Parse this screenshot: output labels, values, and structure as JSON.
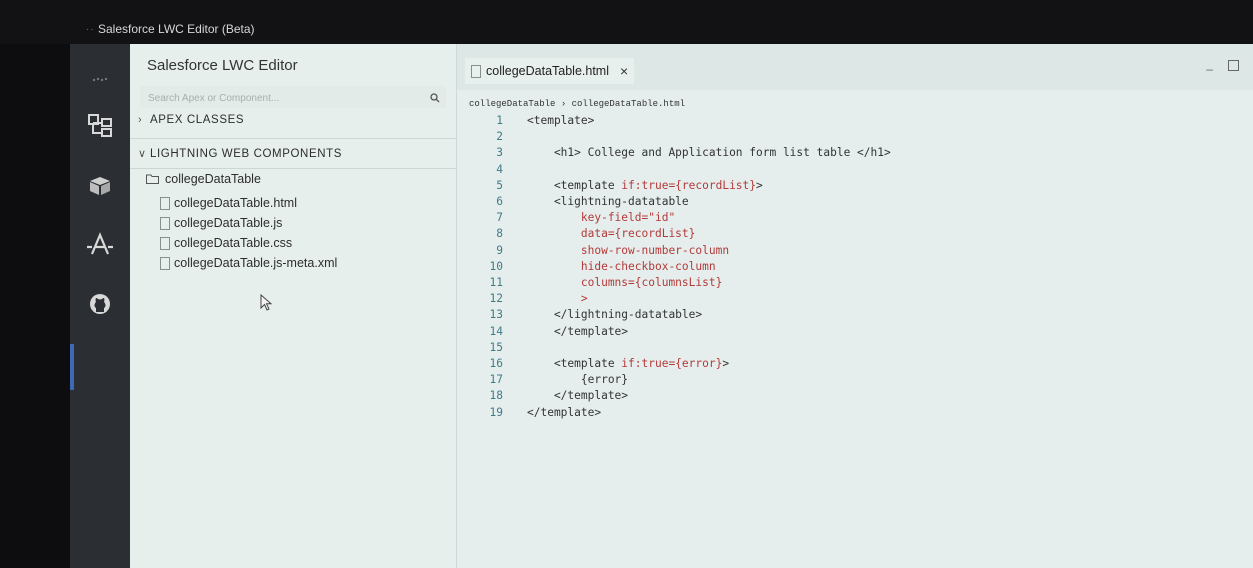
{
  "app": {
    "window_title": "Salesforce LWC Editor (Beta)"
  },
  "sidebar": {
    "brand": "Salesforce LWC Editor",
    "search_placeholder": "Search Apex or Component...",
    "sections": {
      "apex": "APEX CLASSES",
      "lwc": "LIGHTNING WEB COMPONENTS"
    },
    "folder": "collegeDataTable",
    "files": [
      "collegeDataTable.html",
      "collegeDataTable.js",
      "collegeDataTable.css",
      "collegeDataTable.js-meta.xml"
    ]
  },
  "editor": {
    "tab_label": "collegeDataTable.html",
    "tab_close": "×",
    "breadcrumb": "collegeDataTable › collegeDataTable.html",
    "lines": [
      {
        "n": "1",
        "segs": [
          {
            "t": "<template>",
            "c": "tag"
          }
        ]
      },
      {
        "n": "2",
        "segs": []
      },
      {
        "n": "3",
        "segs": [
          {
            "t": "    <h1> College and Application form list table </h1>",
            "c": "tag"
          }
        ]
      },
      {
        "n": "4",
        "segs": []
      },
      {
        "n": "5",
        "segs": [
          {
            "t": "    <template ",
            "c": "tag"
          },
          {
            "t": "if:true={recordList}",
            "c": "attr"
          },
          {
            "t": ">",
            "c": "tag"
          }
        ]
      },
      {
        "n": "6",
        "segs": [
          {
            "t": "    <lightning-datatable",
            "c": "tag"
          }
        ]
      },
      {
        "n": "7",
        "segs": [
          {
            "t": "        key-field=\"id\"",
            "c": "attr"
          }
        ]
      },
      {
        "n": "8",
        "segs": [
          {
            "t": "        data={recordList}",
            "c": "attr"
          }
        ]
      },
      {
        "n": "9",
        "segs": [
          {
            "t": "        show-row-number-column",
            "c": "attr"
          }
        ]
      },
      {
        "n": "10",
        "segs": [
          {
            "t": "        hide-checkbox-column",
            "c": "attr"
          }
        ]
      },
      {
        "n": "11",
        "segs": [
          {
            "t": "        columns={columnsList}",
            "c": "attr"
          }
        ]
      },
      {
        "n": "12",
        "segs": [
          {
            "t": "        >",
            "c": "attr"
          }
        ]
      },
      {
        "n": "13",
        "segs": [
          {
            "t": "    </lightning-datatable>",
            "c": "tag"
          }
        ]
      },
      {
        "n": "14",
        "segs": [
          {
            "t": "    </template>",
            "c": "tag"
          }
        ]
      },
      {
        "n": "15",
        "segs": []
      },
      {
        "n": "16",
        "segs": [
          {
            "t": "    <template ",
            "c": "tag"
          },
          {
            "t": "if:true={error}",
            "c": "attr"
          },
          {
            "t": ">",
            "c": "tag"
          }
        ]
      },
      {
        "n": "17",
        "segs": [
          {
            "t": "        {error}",
            "c": "tag"
          }
        ]
      },
      {
        "n": "18",
        "segs": [
          {
            "t": "    </template>",
            "c": "tag"
          }
        ]
      },
      {
        "n": "19",
        "segs": [
          {
            "t": "</template>",
            "c": "tag"
          }
        ]
      }
    ]
  },
  "icons": {
    "activity": [
      "explorer-icon",
      "cube-icon",
      "salesforce-a-icon",
      "github-icon"
    ],
    "search": "search-icon",
    "folder": "folder-icon",
    "file": "file-icon"
  },
  "colors": {
    "activity_bar": "#2b2f33",
    "accent": "#3f68b5",
    "attr": "#b33a3a",
    "line_numbers": "#3e7c8a"
  }
}
